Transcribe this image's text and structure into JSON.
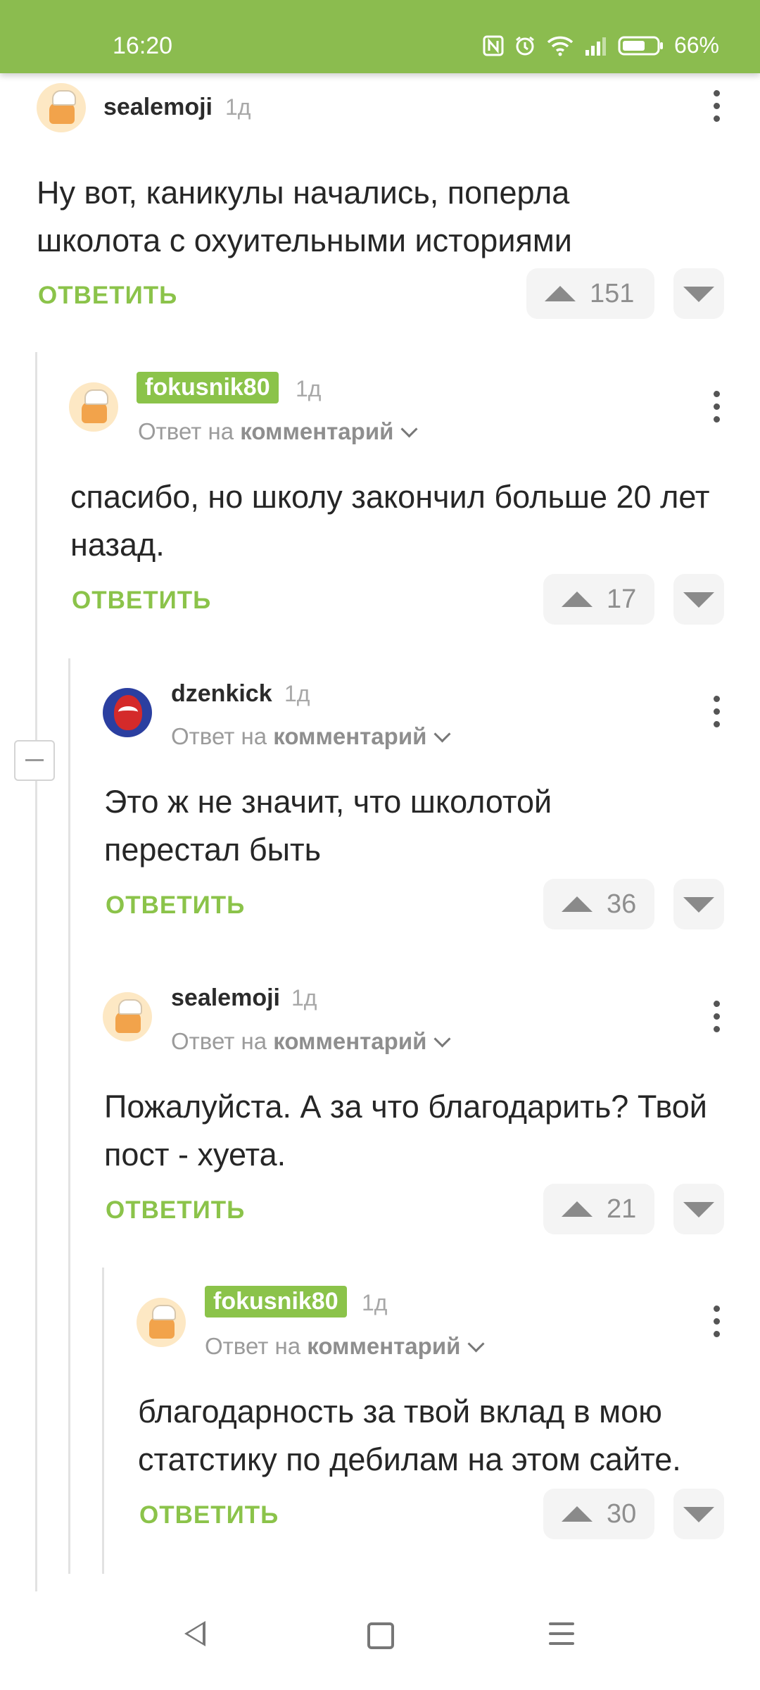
{
  "status_bar": {
    "time": "16:20",
    "battery": "66%",
    "icons": [
      "nfc-icon",
      "alarm-icon",
      "wifi-icon",
      "signal-icon",
      "battery-icon"
    ]
  },
  "comments": [
    {
      "username": "sealemoji",
      "age": "1д",
      "reply_to": null,
      "text": "Ну вот, каникулы начались, поперла школота с охуительными историями",
      "reply_label": "ОТВЕТИТЬ",
      "votes": "151"
    },
    {
      "username": "fokusnik80",
      "age": "1д",
      "reply_to": {
        "prefix": "Ответ на",
        "link": "комментарий"
      },
      "text": "спасибо, но школу закончил больше  20 лет назад.",
      "reply_label": "ОТВЕТИТЬ",
      "votes": "17"
    },
    {
      "username": "dzenkick",
      "age": "1д",
      "reply_to": {
        "prefix": "Ответ на",
        "link": "комментарий"
      },
      "text": "Это ж не значит, что школотой перестал быть",
      "reply_label": "ОТВЕТИТЬ",
      "votes": "36"
    },
    {
      "username": "sealemoji",
      "age": "1д",
      "reply_to": {
        "prefix": "Ответ на",
        "link": "комментарий"
      },
      "text": "Пожалуйста. А за что благодарить? Твой пост - хуета.",
      "reply_label": "ОТВЕТИТЬ",
      "votes": "21"
    },
    {
      "username": "fokusnik80",
      "age": "1д",
      "reply_to": {
        "prefix": "Ответ на",
        "link": "комментарий"
      },
      "text": "благодарность за твой вклад в мою статстику по дебилам на этом сайте.",
      "reply_label": "ОТВЕТИТЬ",
      "votes": "30"
    }
  ],
  "colors": {
    "accent": "#8bc34a",
    "status_bar": "#8bbc4f"
  }
}
